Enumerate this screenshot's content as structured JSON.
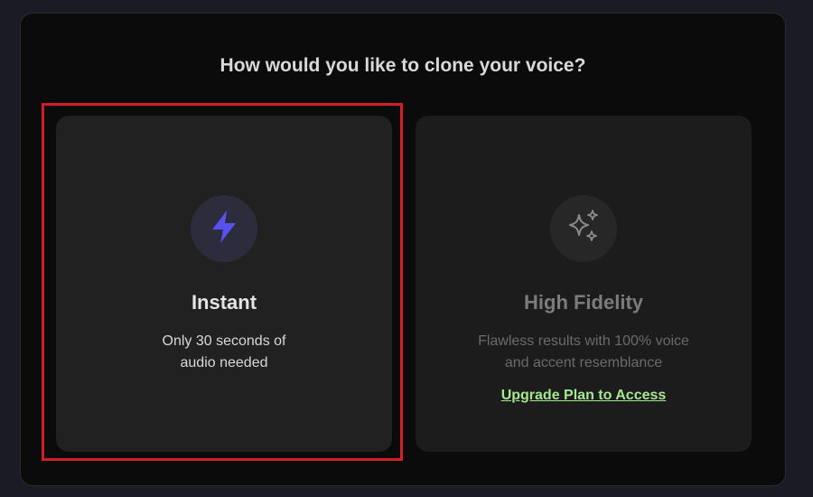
{
  "heading": "How would you like to clone your voice?",
  "options": [
    {
      "title": "Instant",
      "description_line1": "Only 30 seconds of",
      "description_line2": "audio needed",
      "icon": "lightning-bolt-icon",
      "selected": true
    },
    {
      "title": "High Fidelity",
      "description_line1": "Flawless results with 100% voice",
      "description_line2": "and accent resemblance",
      "icon": "sparkles-icon",
      "selected": false,
      "link_label": "Upgrade Plan to Access"
    }
  ],
  "colors": {
    "accent": "#5a4ff0",
    "highlight_border": "#d11f25",
    "link": "#a6e88f"
  }
}
